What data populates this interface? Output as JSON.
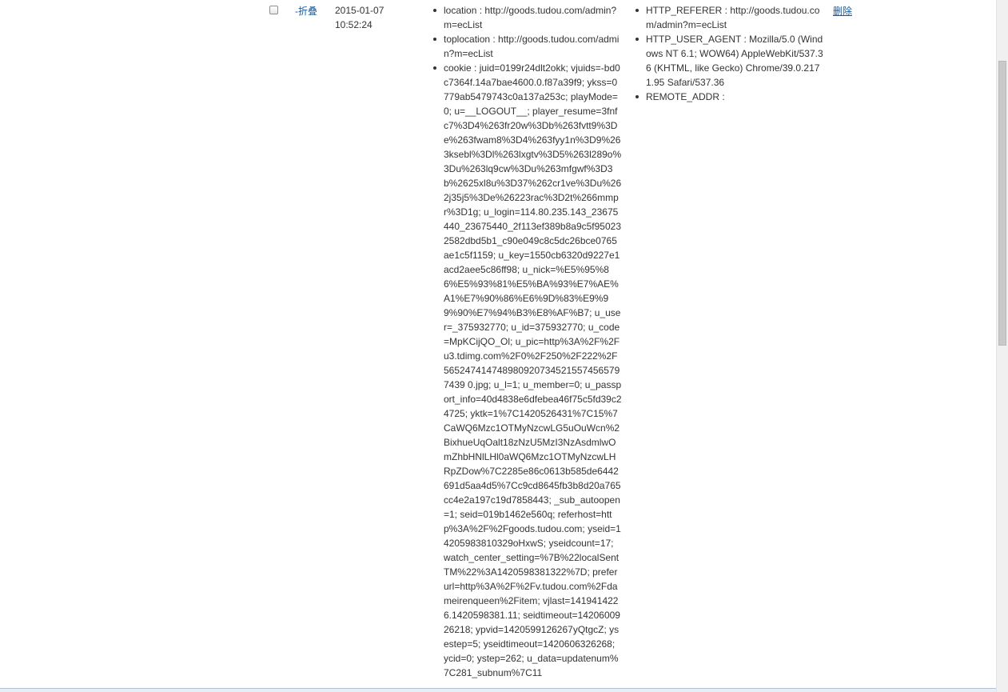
{
  "row": {
    "fold_label": "-折叠",
    "date": "2015-01-07",
    "time": "10:52:24",
    "delete_label": "删除",
    "request_items": [
      "location : http://goods.tudou.com/admin?m=ecList",
      "toplocation : http://goods.tudou.com/admin?m=ecList",
      "cookie : juid=0199r24dlt2okk; vjuids=-bd0c7364f.14a7bae4600.0.f87a39f9; ykss=0779ab5479743c0a137a253c; playMode=0; u=__LOGOUT__; player_resume=3fnfc7%3D4%263fr20w%3Db%263fvtt9%3De%263fwam8%3D4%263fyy1n%3D9%263ksebl%3Dl%263lxgtv%3D5%263l289o%3Du%263lq9cw%3Du%263mfgwf%3D3b%2625xl8u%3D37%262cr1ve%3Du%262j35j5%3De%26223rac%3D2t%266mmpr%3D1g; u_login=114.80.235.143_23675440_23675440_2f113ef389b8a9c5f950232582dbd5b1_c90e049c8c5dc26bce0765ae1c5f1159; u_key=1550cb6320d9227e1acd2aee5c86ff98; u_nick=%E5%95%86%E5%93%81%E5%BA%93%E7%AE%A1%E7%90%86%E6%9D%83%E9%99%90%E7%94%B3%E8%AF%B7; u_user=_375932770; u_id=375932770; u_code=MpKCijQO_Ol; u_pic=http%3A%2F%2Fu3.tdimg.com%2F0%2F250%2F222%2F5652474147489809207345215574565797439 0.jpg; u_l=1; u_member=0; u_passport_info=40d4838e6dfebea46f75c5fd39c24725; yktk=1%7C1420526431%7C15%7CaWQ6Mzc1OTMyNzcwLG5uOuWcn%2BixhueUqOalt18zNzU5MzI3NzAsdmlwOmZhbHNlLHl0aWQ6Mzc1OTMyNzcwLHRpZDow%7C2285e86c0613b585de6442691d5aa4d5%7Cc9cd8645fb3b8d20a765cc4e2a197c19d7858443; _sub_autoopen=1; seid=019b1462e560q; referhost=http%3A%2F%2Fgoods.tudou.com; yseid=14205983810329oHxwS; yseidcount=17; watch_center_setting=%7B%22localSentTM%22%3A1420598381322%7D; preferurl=http%3A%2F%2Fv.tudou.com%2Fdameirenqueen%2Fitem; vjlast=1419414226.1420598381.11; seidtimeout=1420600926218; ypvid=1420599126267yQtgcZ; ysestep=5; yseidtimeout=1420606326268; ycid=0; ystep=262; u_data=updatenum%7C281_subnum%7C11"
    ],
    "server_items": [
      "HTTP_REFERER : http://goods.tudou.com/admin?m=ecList",
      "HTTP_USER_AGENT : Mozilla/5.0 (Windows NT 6.1; WOW64) AppleWebKit/537.36 (KHTML, like Gecko) Chrome/39.0.2171.95 Safari/537.36",
      "REMOTE_ADDR :"
    ]
  }
}
